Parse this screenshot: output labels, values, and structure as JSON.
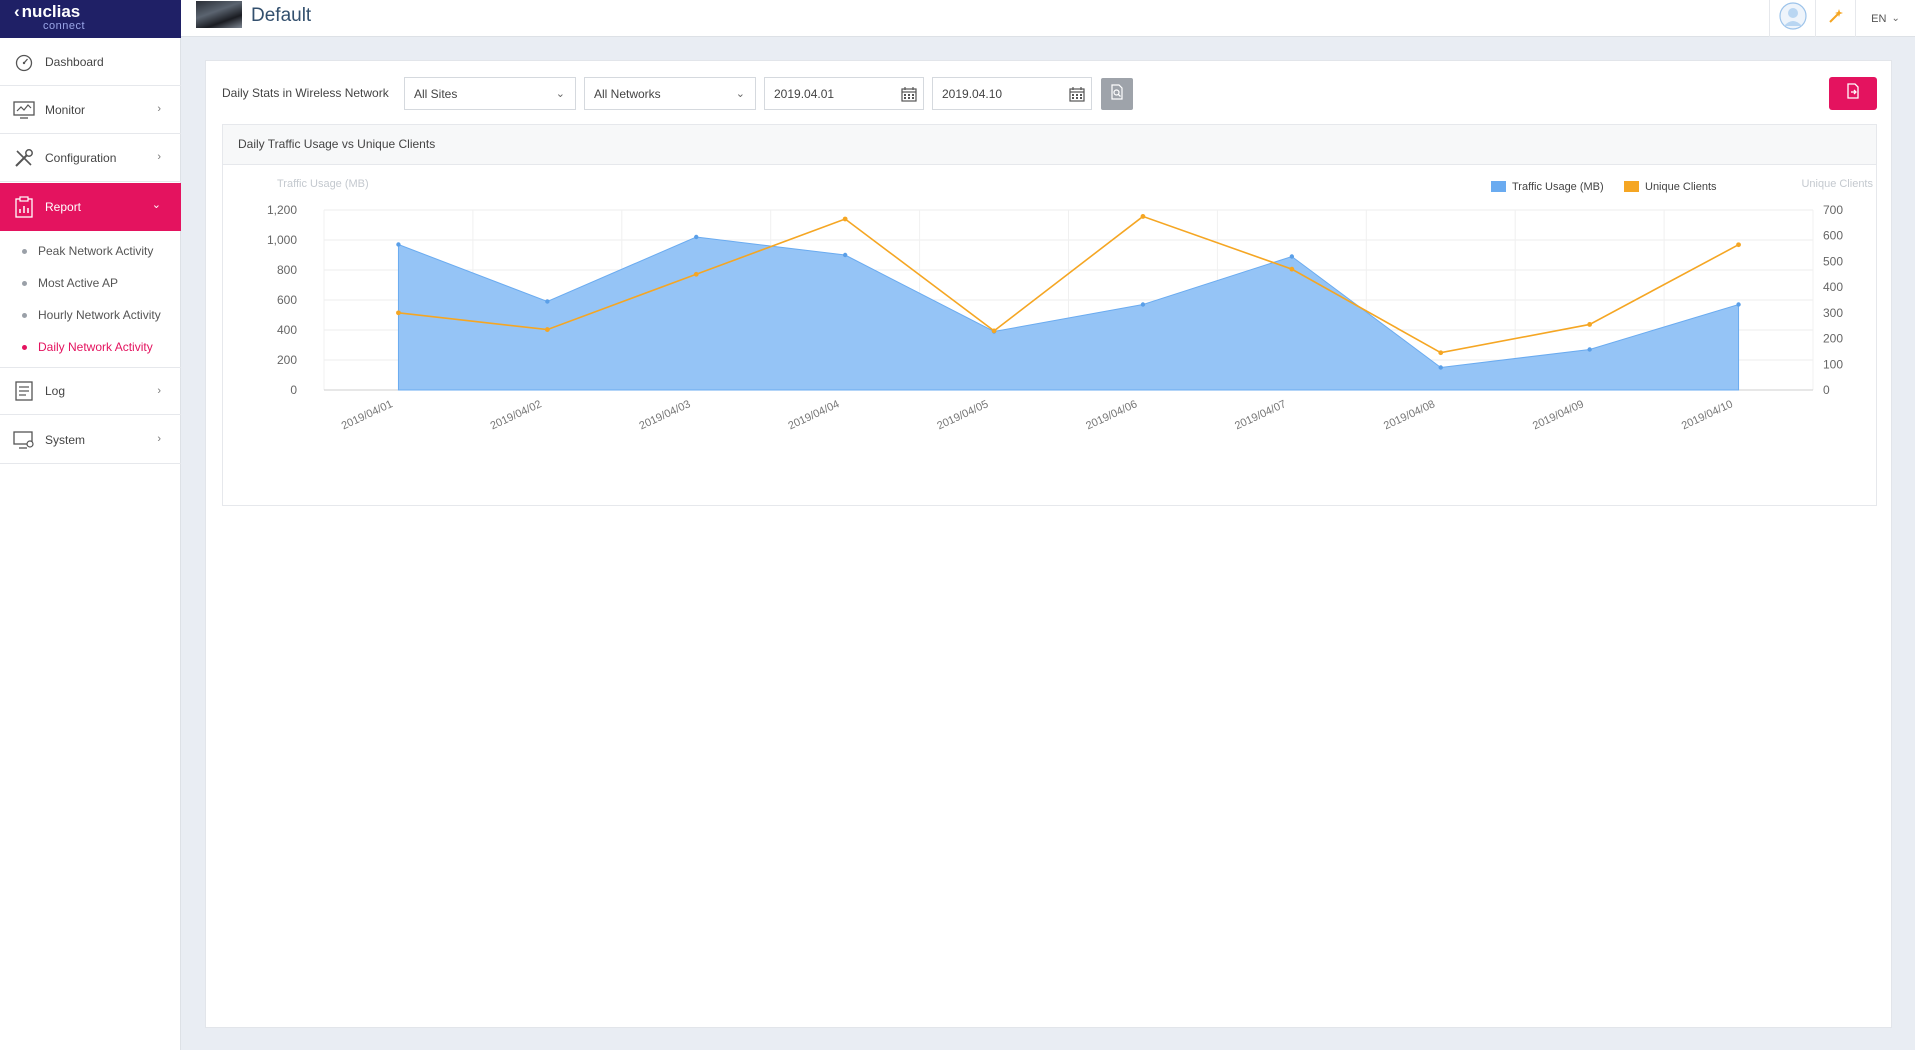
{
  "logo": {
    "brand": "nuclias",
    "sub": "connect"
  },
  "sidebar": {
    "items": [
      {
        "label": "Dashboard",
        "icon": "dashboard-icon"
      },
      {
        "label": "Monitor",
        "icon": "monitor-icon"
      },
      {
        "label": "Configuration",
        "icon": "tools-icon"
      },
      {
        "label": "Report",
        "icon": "report-icon"
      },
      {
        "label": "Log",
        "icon": "log-icon"
      },
      {
        "label": "System",
        "icon": "system-icon"
      }
    ],
    "report_sub": [
      {
        "label": "Peak Network Activity"
      },
      {
        "label": "Most Active AP"
      },
      {
        "label": "Hourly Network Activity"
      },
      {
        "label": "Daily Network Activity"
      }
    ]
  },
  "header": {
    "title": "Default",
    "lang": "EN"
  },
  "filters": {
    "label": "Daily Stats in Wireless Network",
    "site": "All Sites",
    "network": "All Networks",
    "start_date": "2019.04.01",
    "end_date": "2019.04.10"
  },
  "panel": {
    "title": "Daily Traffic Usage vs Unique Clients"
  },
  "colors": {
    "accent": "#e4135f",
    "navy": "#1f2066",
    "traffic": "#6aabf0",
    "clients": "#f5a623"
  },
  "chart_data": {
    "type": "area",
    "title": "Daily Traffic Usage vs Unique Clients",
    "categories": [
      "2019/04/01",
      "2019/04/02",
      "2019/04/03",
      "2019/04/04",
      "2019/04/05",
      "2019/04/06",
      "2019/04/07",
      "2019/04/08",
      "2019/04/09",
      "2019/04/10"
    ],
    "series": [
      {
        "name": "Traffic Usage (MB)",
        "type": "area",
        "axis": "left",
        "color": "#6aabf0",
        "values": [
          970,
          590,
          1020,
          900,
          390,
          570,
          890,
          150,
          270,
          570
        ]
      },
      {
        "name": "Unique Clients",
        "type": "line",
        "axis": "right",
        "color": "#f5a623",
        "values": [
          300,
          235,
          450,
          665,
          230,
          675,
          470,
          145,
          255,
          565
        ]
      }
    ],
    "ylabel_left": "Traffic Usage (MB)",
    "ylabel_right": "Unique Clients",
    "ylim_left": [
      0,
      1200
    ],
    "yticks_left": [
      "0",
      "200",
      "400",
      "600",
      "800",
      "1,000",
      "1,200"
    ],
    "ylim_right": [
      0,
      700
    ],
    "yticks_right": [
      "0",
      "100",
      "200",
      "300",
      "400",
      "500",
      "600",
      "700"
    ],
    "grid": true,
    "legend": "top-right"
  }
}
